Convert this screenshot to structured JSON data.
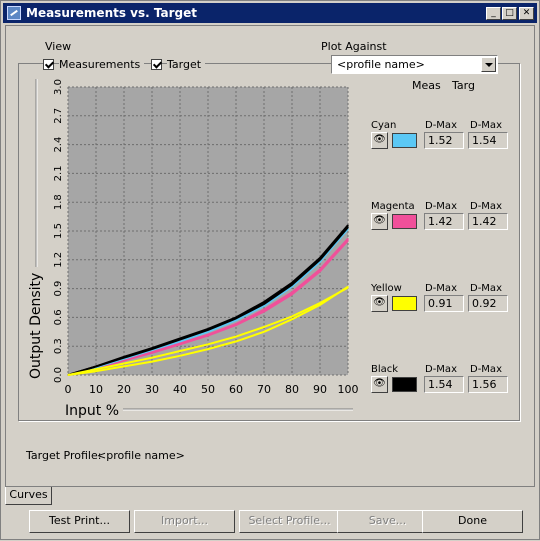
{
  "window": {
    "title": "Measurements vs. Target"
  },
  "view": {
    "label": "View",
    "measurements_label": "Measurements",
    "target_label": "Target",
    "measurements_checked": true,
    "target_checked": true
  },
  "plot_against": {
    "label": "Plot Against",
    "selected": "<profile name>",
    "col_meas": "Meas",
    "col_targ": "Targ"
  },
  "channels": [
    {
      "name": "Cyan",
      "color": "#5bc8f5",
      "dmax_label": "D-Max",
      "meas": "1.52",
      "targ": "1.54"
    },
    {
      "name": "Magenta",
      "color": "#f0509a",
      "dmax_label": "D-Max",
      "meas": "1.42",
      "targ": "1.42"
    },
    {
      "name": "Yellow",
      "color": "#ffff00",
      "dmax_label": "D-Max",
      "meas": "0.91",
      "targ": "0.92"
    },
    {
      "name": "Black",
      "color": "#000000",
      "dmax_label": "D-Max",
      "meas": "1.54",
      "targ": "1.56"
    }
  ],
  "chart_data": {
    "type": "line",
    "xlabel": "Input %",
    "ylabel": "Output Density",
    "xlim": [
      0,
      100
    ],
    "ylim": [
      0,
      3.0
    ],
    "x_ticks": [
      "0",
      "10",
      "20",
      "30",
      "40",
      "50",
      "60",
      "70",
      "80",
      "90",
      "100"
    ],
    "y_ticks": [
      "0.0",
      "0.3",
      "0.6",
      "0.9",
      "1.2",
      "1.5",
      "1.8",
      "2.1",
      "2.4",
      "2.7",
      "3.0"
    ],
    "grid": true,
    "x": [
      0,
      10,
      20,
      30,
      40,
      50,
      60,
      70,
      80,
      90,
      100
    ],
    "series": [
      {
        "color": "#f0509a",
        "values": [
          0,
          0.08,
          0.16,
          0.24,
          0.33,
          0.42,
          0.53,
          0.68,
          0.86,
          1.1,
          1.42
        ]
      },
      {
        "color": "#f0509a",
        "values": [
          0,
          0.07,
          0.15,
          0.23,
          0.32,
          0.41,
          0.52,
          0.66,
          0.84,
          1.08,
          1.4
        ]
      },
      {
        "color": "#5bc8f5",
        "values": [
          0,
          0.08,
          0.17,
          0.26,
          0.35,
          0.45,
          0.57,
          0.72,
          0.92,
          1.18,
          1.52
        ]
      },
      {
        "color": "#5bc8f5",
        "values": [
          0,
          0.08,
          0.17,
          0.26,
          0.36,
          0.46,
          0.58,
          0.73,
          0.93,
          1.19,
          1.54
        ]
      },
      {
        "color": "#000000",
        "values": [
          0,
          0.09,
          0.18,
          0.27,
          0.37,
          0.47,
          0.59,
          0.74,
          0.94,
          1.2,
          1.54
        ]
      },
      {
        "color": "#000000",
        "values": [
          0,
          0.09,
          0.19,
          0.28,
          0.38,
          0.48,
          0.6,
          0.76,
          0.96,
          1.22,
          1.56
        ]
      },
      {
        "color": "#ffff00",
        "values": [
          0,
          0.06,
          0.12,
          0.18,
          0.25,
          0.32,
          0.4,
          0.5,
          0.61,
          0.75,
          0.91
        ]
      },
      {
        "color": "#ffff00",
        "values": [
          0,
          0.04,
          0.09,
          0.14,
          0.2,
          0.27,
          0.35,
          0.45,
          0.58,
          0.73,
          0.92
        ]
      }
    ]
  },
  "footer": {
    "target_profile_label": "Target Profile:",
    "target_profile_value": "<profile name>"
  },
  "tabs": [
    {
      "label": "Curves"
    }
  ],
  "buttons": {
    "test_print": "Test Print...",
    "import": "Import...",
    "select_profile": "Select Profile...",
    "save": "Save...",
    "done": "Done"
  }
}
